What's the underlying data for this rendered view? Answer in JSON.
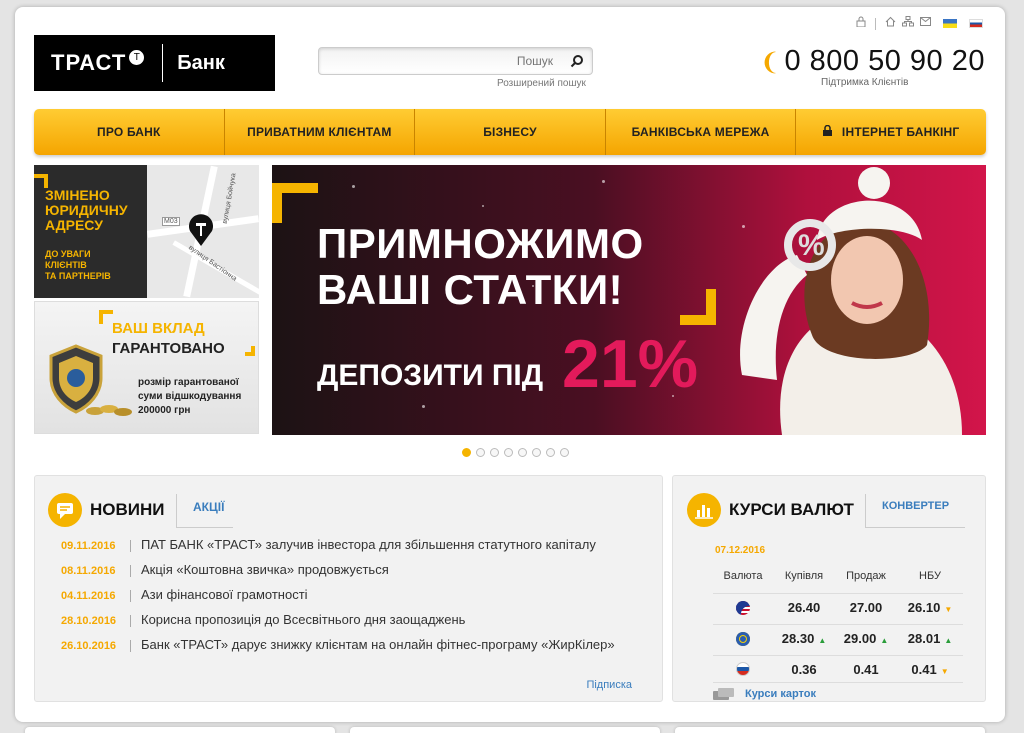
{
  "header": {
    "logo_word": "ТРАСТ",
    "logo_mark": "Т",
    "logo_bank": "Банк",
    "search_placeholder": "Пошук",
    "advanced_search": "Розширений пошук",
    "phone": "0 800 50 90 20",
    "support": "Підтримка Клієнтів"
  },
  "nav": {
    "items": [
      "ПРО БАНК",
      "ПРИВАТНИМ КЛІЄНТАМ",
      "БІЗНЕСУ",
      "БАНКІВСЬКА МЕРЕЖА",
      "ІНТЕРНЕТ БАНКІНГ"
    ]
  },
  "promo_address": {
    "title_lines": [
      "ЗМІНЕНО",
      "ЮРИДИЧНУ",
      "АДРЕСУ"
    ],
    "note_lines": [
      "ДО УВАГИ",
      "КЛІЄНТІВ",
      "ТА ПАРТНЕРІВ"
    ],
    "street1": "вулиця Бастіонна",
    "street2": "вулиця Бойчука",
    "road": "М03"
  },
  "promo_deposit": {
    "line1": "ВАШ ВКЛАД",
    "line2": "ГАРАНТОВАНО",
    "line3": "розмір гарантованої суми відшкодування 200000 грн"
  },
  "banner": {
    "headline_line1": "ПРИМНОЖИМО",
    "headline_line2": "ВАШІ СТАТКИ!",
    "sub": "ДЕПОЗИТИ ПІД",
    "percent": "21%",
    "slide_count": 8,
    "active_slide": 1
  },
  "news": {
    "title": "НОВИНИ",
    "tab": "АКЦІЇ",
    "items": [
      {
        "date": "09.11.2016",
        "text": "ПАТ БАНК «ТРАСТ» залучив інвестора для збільшення статутного капіталу"
      },
      {
        "date": "08.11.2016",
        "text": "Акція «Коштовна звичка» продовжується"
      },
      {
        "date": "04.11.2016",
        "text": "Ази фінансової грамотності"
      },
      {
        "date": "28.10.2016",
        "text": "Корисна пропозиція до Всесвітнього дня заощаджень"
      },
      {
        "date": "26.10.2016",
        "text": "Банк «ТРАСТ» дарує знижку клієнтам на онлайн фітнес-програму «ЖирКілер»"
      }
    ],
    "subscribe": "Підписка"
  },
  "fx": {
    "title": "КУРСИ ВАЛЮТ",
    "tab": "КОНВЕРТЕР",
    "date": "07.12.2016",
    "headers": [
      "Валюта",
      "Купівля",
      "Продаж",
      "НБУ"
    ],
    "rows": [
      {
        "currency_icon": "usd-flag-icon",
        "buy": "26.40",
        "sell": "27.00",
        "nbu": "26.10",
        "buy_trend": "",
        "sell_trend": "",
        "nbu_trend": "down"
      },
      {
        "currency_icon": "eur-flag-icon",
        "buy": "28.30",
        "sell": "29.00",
        "nbu": "28.01",
        "buy_trend": "up",
        "sell_trend": "up",
        "nbu_trend": "up"
      },
      {
        "currency_icon": "rub-flag-icon",
        "buy": "0.36",
        "sell": "0.41",
        "nbu": "0.41",
        "buy_trend": "",
        "sell_trend": "",
        "nbu_trend": "down"
      }
    ],
    "cards_link": "Курси карток"
  },
  "colors": {
    "accent": "#f5b400",
    "link": "#3a7dbd",
    "trend_up": "#2a9d3a",
    "trend_down": "#f5a800"
  }
}
